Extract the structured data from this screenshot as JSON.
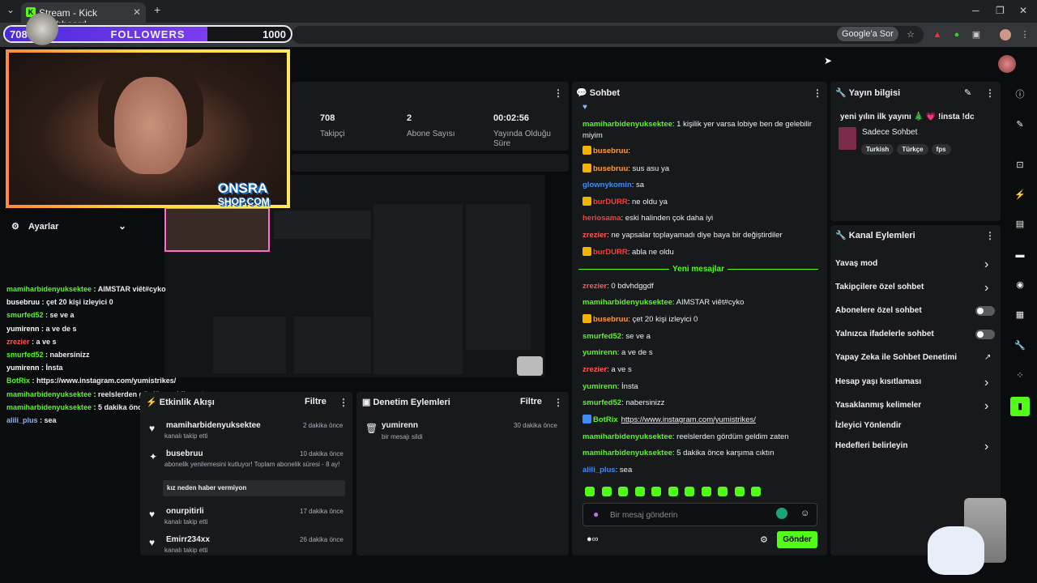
{
  "browser": {
    "tab_title": "Stream - Kick Dashboard",
    "google_sor": "Google'a Sor"
  },
  "overlay": {
    "followers_current": "708",
    "followers_label": "FOLLOWERS",
    "followers_goal": "1000",
    "followers_progress": 0.708,
    "brand": "ONSRA",
    "brand2": "SHOP.COM"
  },
  "stats": [
    {
      "value": "708",
      "label": "Takipçi"
    },
    {
      "value": "2",
      "label": "Abone Sayısı"
    },
    {
      "value": "00:02:56",
      "label": "Yayında Olduğu Süre"
    }
  ],
  "settings": {
    "title": "Ayarlar"
  },
  "overlay_chat": [
    {
      "user": "mamiharbidenyuksektee",
      "text": " : AIMSTAR viêt#cyko",
      "color": "#53fc18"
    },
    {
      "user": "busebruu",
      "text": " : çet 20 kişi izleyici 0",
      "color": "#ffffff"
    },
    {
      "user": "smurfed52",
      "text": " : se ve a",
      "color": "#53fc18"
    },
    {
      "user": "yumirenn",
      "text": " : a ve de s",
      "color": "#ffffff"
    },
    {
      "user": "zrezier",
      "text": " : a ve s",
      "color": "#ff5a5a"
    },
    {
      "user": "smurfed52",
      "text": " : nabersinizz",
      "color": "#53fc18"
    },
    {
      "user": "yumirenn",
      "text": " : İnsta",
      "color": "#ffffff"
    },
    {
      "user": "BotRix",
      "text": " : https://www.instagram.com/yumistrikes/",
      "color": "#53fc18"
    },
    {
      "user": "mamiharbidenyuksektee",
      "text": " : reelslerden gördüm geldim zaten",
      "color": "#53fc18"
    },
    {
      "user": "mamiharbidenyuksektee",
      "text": " : 5 dakika önce karşıma cıktın",
      "color": "#53fc18"
    },
    {
      "user": "alili_plus",
      "text": " : sea",
      "color": "#8ab4f8"
    }
  ],
  "activity": {
    "title": "Etkinlik Akışı",
    "filter": "Filtre",
    "items": [
      {
        "name": "mamiharbidenyuksektee",
        "desc": "kanalı takip etti",
        "time": "2 dakika önce"
      },
      {
        "name": "busebruu",
        "desc": "abonelik yenilemesini kutluyor! Toplam abonelik süresi - 8 ay!",
        "time": "10 dakika önce",
        "note": "kız neden haber vermiyon",
        "highlight": "8"
      },
      {
        "name": "onurpitirli",
        "desc": "kanalı takip etti",
        "time": "17 dakika önce"
      },
      {
        "name": "Emirr234xx",
        "desc": "kanalı takip etti",
        "time": "26 dakika önce"
      }
    ]
  },
  "moderation": {
    "title": "Denetim Eylemleri",
    "filter": "Filtre",
    "items": [
      {
        "name": "yumirenn",
        "desc": "bir mesajı sildi",
        "time": "30 dakika önce"
      }
    ]
  },
  "chat": {
    "title": "Sohbet",
    "messages": [
      {
        "user": "mamiharbidenyuksektee",
        "text": ": 1 kişilik yer varsa lobiye ben de gelebilir miyim",
        "color": "#53fc18"
      },
      {
        "user": "busebruu",
        "text": ":",
        "color": "#ff9a3c"
      },
      {
        "user": "busebruu",
        "text": ": sus asu ya",
        "color": "#ff9a3c"
      },
      {
        "user": "glownykomin",
        "text": ": sa",
        "color": "#3c8cff"
      },
      {
        "user": "burDURR",
        "text": ": ne oldu ya",
        "color": "#ff3c3c"
      },
      {
        "user": "heriosama",
        "text": ": eski halinden çok daha iyi",
        "color": "#ff3c3c"
      },
      {
        "user": "zrezier",
        "text": ": ne yapsalar toplayamadı diye baya bir değiştirdiler",
        "color": "#ff5a5a"
      },
      {
        "user": "burDURR",
        "text": ": abla ne oldu",
        "color": "#ff3c3c"
      },
      {
        "user": "zrezier",
        "text": ": 0 bdvhdggdf",
        "color": "#ff5a5a"
      },
      {
        "user": "mamiharbidenyuksektee",
        "text": ": AIMSTAR viêt#cyko",
        "color": "#53fc18"
      },
      {
        "user": "busebruu",
        "text": ": çet 20 kişi izleyici 0",
        "color": "#ff9a3c"
      },
      {
        "user": "smurfed52",
        "text": ": se ve a",
        "color": "#53fc18"
      },
      {
        "user": "yumirenn",
        "text": ": a ve de s",
        "color": "#53fc18"
      },
      {
        "user": "zrezier",
        "text": ": a ve s",
        "color": "#ff5a5a"
      },
      {
        "user": "yumirenn",
        "text": ": İnsta",
        "color": "#53fc18"
      },
      {
        "user": "smurfed52",
        "text": ": nabersinizz",
        "color": "#53fc18"
      },
      {
        "user": "BotRix",
        "text": "https://www.instagram.com/yumistrikes/",
        "color": "#53fc18"
      },
      {
        "user": "mamiharbidenyuksektee",
        "text": ": reelslerden gördüm geldim zaten",
        "color": "#53fc18"
      },
      {
        "user": "mamiharbidenyuksektee",
        "text": ": 5 dakika önce karşıma cıktın",
        "color": "#53fc18"
      },
      {
        "user": "alili_plus",
        "text": ": sea",
        "color": "#3c8cff"
      }
    ],
    "new_messages": "Yeni mesajlar",
    "input_placeholder": "Bir mesaj gönderin",
    "send_label": "Gönder"
  },
  "stream_info": {
    "title": "Yayın bilgisi",
    "stream_title": "yeni yılın ilk yayını 🎄 💗 !insta !dc",
    "category": "Sadece Sohbet",
    "tags": [
      "Turkish",
      "Türkçe",
      "fps"
    ]
  },
  "channel_actions": {
    "title": "Kanal Eylemleri",
    "items": [
      {
        "label": "Yavaş mod",
        "kind": "chevron"
      },
      {
        "label": "Takipçilere özel sohbet",
        "kind": "chevron"
      },
      {
        "label": "Abonelere özel sohbet",
        "kind": "toggle"
      },
      {
        "label": "Yalnızca ifadelerle sohbet",
        "kind": "toggle"
      },
      {
        "label": "Yapay Zeka ile Sohbet Denetimi",
        "kind": "external"
      },
      {
        "label": "Hesap yaşı kısıtlaması",
        "kind": "chevron"
      },
      {
        "label": "Yasaklanmış kelimeler",
        "kind": "chevron"
      },
      {
        "label": "İzleyici Yönlendir",
        "kind": "none"
      },
      {
        "label": "Hedefleri belirleyin",
        "kind": "chevron"
      }
    ]
  }
}
